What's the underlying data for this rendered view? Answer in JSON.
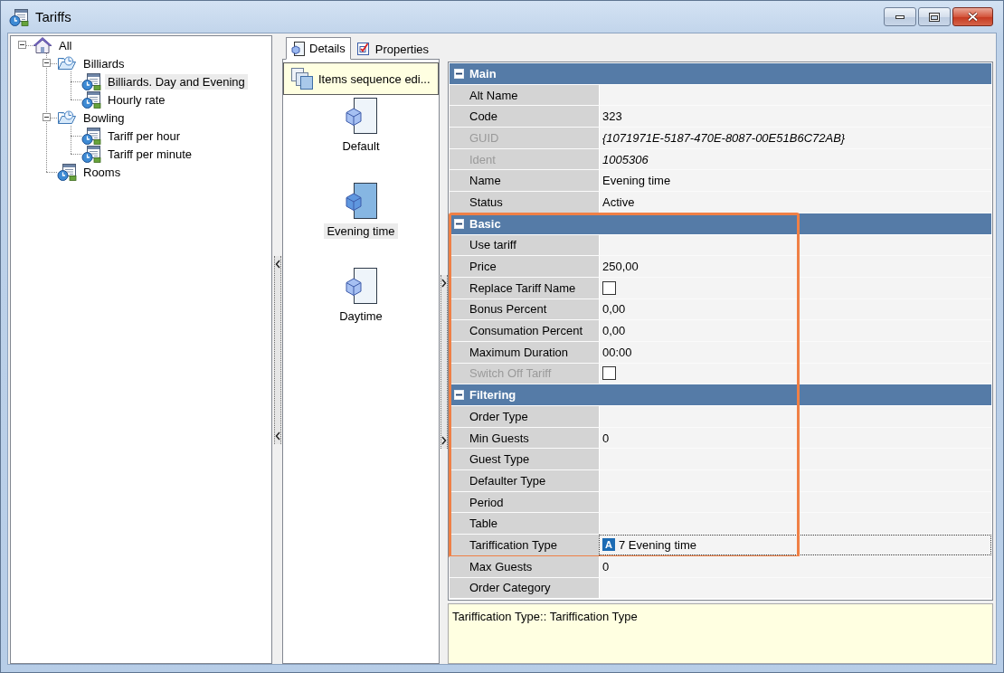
{
  "window": {
    "title": "Tariffs"
  },
  "tree": [
    {
      "label": "All",
      "kind": "home",
      "expanded": true,
      "selected": false,
      "children": [
        {
          "label": "Billiards",
          "kind": "folder",
          "expanded": true,
          "selected": false,
          "children": [
            {
              "label": "Billiards. Day and Evening",
              "kind": "tariff",
              "selected": true
            },
            {
              "label": "Hourly rate",
              "kind": "tariff",
              "selected": false
            }
          ]
        },
        {
          "label": "Bowling",
          "kind": "folder",
          "expanded": true,
          "selected": false,
          "children": [
            {
              "label": "Tariff per hour",
              "kind": "tariff",
              "selected": false
            },
            {
              "label": "Tariff per minute",
              "kind": "tariff",
              "selected": false
            }
          ]
        },
        {
          "label": "Rooms",
          "kind": "tariff",
          "selected": false
        }
      ]
    }
  ],
  "detail_tabs": [
    {
      "label": "Details",
      "selected": true
    },
    {
      "label": "Properties",
      "selected": false
    }
  ],
  "sequence_editor": {
    "title": "Items sequence edi...",
    "items": [
      {
        "label": "Default",
        "selected": false
      },
      {
        "label": "Evening time",
        "selected": true
      },
      {
        "label": "Daytime",
        "selected": false
      }
    ]
  },
  "property_grid": {
    "blocks": [
      {
        "highlighted": false,
        "entries": [
          {
            "kind": "category",
            "name": "Main",
            "expanded": true
          },
          {
            "kind": "text",
            "label": "Alt Name",
            "disabled": false,
            "selected": false
          },
          {
            "kind": "text",
            "label": "Code",
            "value": "323",
            "disabled": false,
            "selected": false
          },
          {
            "kind": "text",
            "label": "GUID",
            "value": "{1071971E-5187-470E-8087-00E51B6C72AB}",
            "disabled": true,
            "selected": false
          },
          {
            "kind": "text",
            "label": "Ident",
            "value": "1005306",
            "disabled": true,
            "selected": false
          },
          {
            "kind": "text",
            "label": "Name",
            "value": "Evening time",
            "disabled": false,
            "selected": false
          },
          {
            "kind": "text",
            "label": "Status",
            "value": "Active",
            "disabled": false,
            "selected": false
          }
        ]
      },
      {
        "highlighted": true,
        "entries": [
          {
            "kind": "category",
            "name": "Basic",
            "expanded": true
          },
          {
            "kind": "text",
            "label": "Use tariff",
            "disabled": false,
            "selected": false
          },
          {
            "kind": "text",
            "label": "Price",
            "value": "250,00",
            "disabled": false,
            "selected": false
          },
          {
            "kind": "checkbox",
            "label": "Replace Tariff Name",
            "checked": false,
            "disabled": false,
            "selected": false
          },
          {
            "kind": "text",
            "label": "Bonus Percent",
            "value": "0,00",
            "disabled": false,
            "selected": false
          },
          {
            "kind": "text",
            "label": "Consumation Percent",
            "value": "0,00",
            "disabled": false,
            "selected": false
          },
          {
            "kind": "text",
            "label": "Maximum Duration",
            "value": "00:00",
            "disabled": false,
            "selected": false
          },
          {
            "kind": "checkbox",
            "label": "Switch Off Tariff",
            "checked": false,
            "disabled": true,
            "selected": false
          },
          {
            "kind": "category",
            "name": "Filtering",
            "expanded": true
          },
          {
            "kind": "text",
            "label": "Order Type",
            "disabled": false,
            "selected": false
          },
          {
            "kind": "text",
            "label": "Min Guests",
            "value": "0",
            "disabled": false,
            "selected": false
          },
          {
            "kind": "text",
            "label": "Guest Type",
            "disabled": false,
            "selected": false
          },
          {
            "kind": "text",
            "label": "Defaulter Type",
            "disabled": false,
            "selected": false
          },
          {
            "kind": "text",
            "label": "Period",
            "disabled": false,
            "selected": false
          },
          {
            "kind": "text",
            "label": "Table",
            "disabled": false,
            "selected": false
          },
          {
            "kind": "reference",
            "label": "Tariffication Type",
            "badge": "A",
            "value": "7 Evening time",
            "disabled": false,
            "selected": true
          }
        ]
      },
      {
        "highlighted": false,
        "entries": [
          {
            "kind": "text",
            "label": "Max Guests",
            "value": "0",
            "disabled": false,
            "selected": false
          },
          {
            "kind": "text",
            "label": "Order Category",
            "disabled": false,
            "selected": false
          }
        ]
      }
    ]
  },
  "description": {
    "text": "Tariffication Type:: Tariffication Type"
  }
}
